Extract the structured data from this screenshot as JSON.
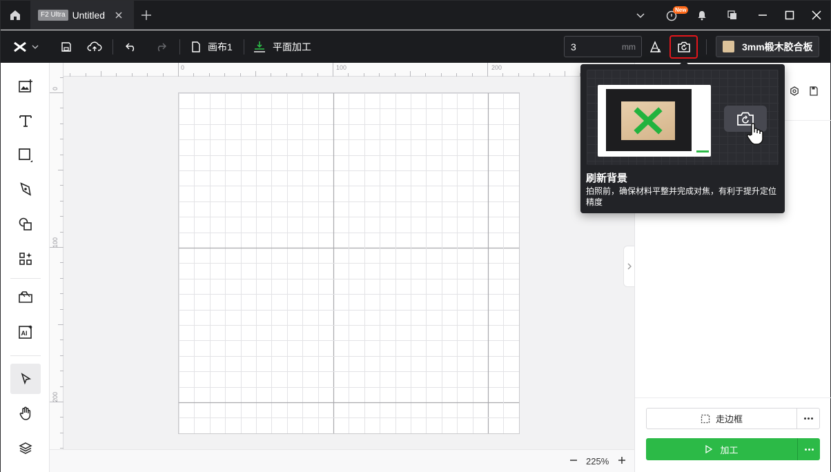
{
  "titlebar": {
    "machine_tag": "F2 Ultra",
    "document_title": "Untitled",
    "new_badge": "New"
  },
  "toolbar": {
    "canvas_label": "画布1",
    "mode_label": "平面加工",
    "thickness_value": "3",
    "thickness_unit": "mm",
    "material_label": "3mm椴木胶合板",
    "material_color": "#dcc29a"
  },
  "tooltip": {
    "title": "刷新背景",
    "description": "拍照前，确保材料平整并完成对焦，有利于提升定位精度"
  },
  "ruler": {
    "top_ticks": [
      "0",
      "100",
      "200"
    ],
    "left_ticks": [
      "0",
      "100",
      "200"
    ]
  },
  "zoom": {
    "value": "225%"
  },
  "actions": {
    "frame_label": "走边框",
    "process_label": "加工"
  },
  "colors": {
    "accent_green": "#2cba47",
    "highlight_red": "#e3161b",
    "titlebar_bg": "#1b1c1f"
  }
}
